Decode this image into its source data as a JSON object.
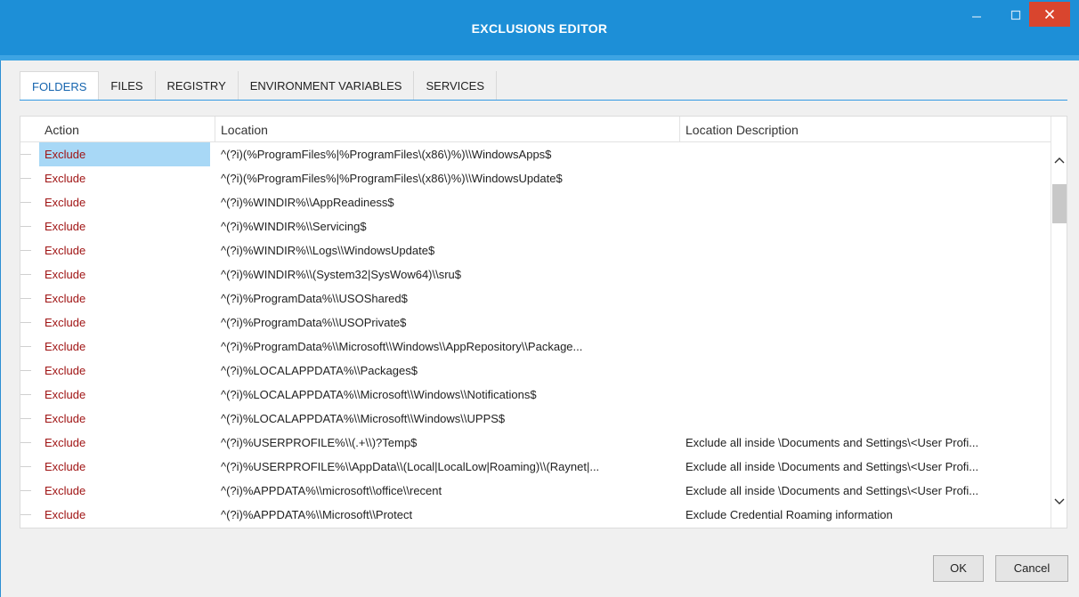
{
  "window": {
    "title": "EXCLUSIONS EDITOR",
    "accent": "#1d8fd7",
    "close_color": "#d9452e",
    "controls": {
      "minimize_icon": "minimize-icon",
      "maximize_icon": "maximize-icon",
      "close_icon": "close-icon"
    }
  },
  "tabs": [
    {
      "label": "FOLDERS",
      "active": true
    },
    {
      "label": "FILES",
      "active": false
    },
    {
      "label": "REGISTRY",
      "active": false
    },
    {
      "label": "ENVIRONMENT VARIABLES",
      "active": false
    },
    {
      "label": "SERVICES",
      "active": false
    }
  ],
  "table": {
    "columns": [
      "Action",
      "Location",
      "Location Description"
    ],
    "rows": [
      {
        "action": "Exclude",
        "location": "^(?i)(%ProgramFiles%|%ProgramFiles\\(x86\\)%)\\\\WindowsApps$",
        "description": ""
      },
      {
        "action": "Exclude",
        "location": "^(?i)(%ProgramFiles%|%ProgramFiles\\(x86\\)%)\\\\WindowsUpdate$",
        "description": ""
      },
      {
        "action": "Exclude",
        "location": "^(?i)%WINDIR%\\\\AppReadiness$",
        "description": ""
      },
      {
        "action": "Exclude",
        "location": "^(?i)%WINDIR%\\\\Servicing$",
        "description": ""
      },
      {
        "action": "Exclude",
        "location": "^(?i)%WINDIR%\\\\Logs\\\\WindowsUpdate$",
        "description": ""
      },
      {
        "action": "Exclude",
        "location": "^(?i)%WINDIR%\\\\(System32|SysWow64)\\\\sru$",
        "description": ""
      },
      {
        "action": "Exclude",
        "location": "^(?i)%ProgramData%\\\\USOShared$",
        "description": ""
      },
      {
        "action": "Exclude",
        "location": "^(?i)%ProgramData%\\\\USOPrivate$",
        "description": ""
      },
      {
        "action": "Exclude",
        "location": "^(?i)%ProgramData%\\\\Microsoft\\\\Windows\\\\AppRepository\\\\Package...",
        "description": ""
      },
      {
        "action": "Exclude",
        "location": "^(?i)%LOCALAPPDATA%\\\\Packages$",
        "description": ""
      },
      {
        "action": "Exclude",
        "location": "^(?i)%LOCALAPPDATA%\\\\Microsoft\\\\Windows\\\\Notifications$",
        "description": ""
      },
      {
        "action": "Exclude",
        "location": "^(?i)%LOCALAPPDATA%\\\\Microsoft\\\\Windows\\\\UPPS$",
        "description": ""
      },
      {
        "action": "Exclude",
        "location": "^(?i)%USERPROFILE%\\\\(.+\\\\)?Temp$",
        "description": "Exclude all inside \\Documents and Settings\\<User Profi..."
      },
      {
        "action": "Exclude",
        "location": "^(?i)%USERPROFILE%\\\\AppData\\\\(Local|LocalLow|Roaming)\\\\(Raynet|...",
        "description": "Exclude all inside \\Documents and Settings\\<User Profi..."
      },
      {
        "action": "Exclude",
        "location": "^(?i)%APPDATA%\\\\microsoft\\\\office\\\\recent",
        "description": "Exclude all inside \\Documents and Settings\\<User Profi..."
      },
      {
        "action": "Exclude",
        "location": "^(?i)%APPDATA%\\\\Microsoft\\\\Protect",
        "description": "Exclude Credential Roaming information"
      }
    ],
    "selected_row": 0,
    "action_color": "#a01515",
    "selection_color": "#a8d8f6"
  },
  "scrollbar": {
    "up_icon": "chevron-up-icon",
    "down_icon": "chevron-down-icon"
  },
  "footer": {
    "ok_label": "OK",
    "cancel_label": "Cancel"
  }
}
